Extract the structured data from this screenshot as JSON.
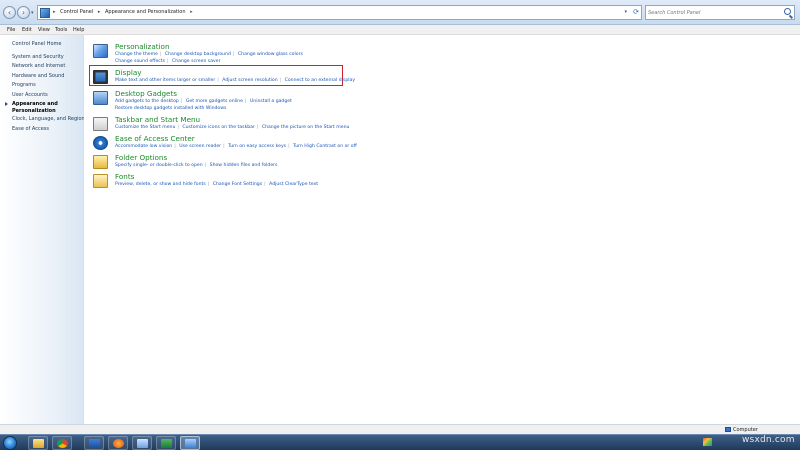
{
  "address_bar": {
    "breadcrumbs": [
      "Control Panel",
      "Appearance and Personalization"
    ],
    "search_placeholder": "Search Control Panel"
  },
  "menu": [
    "File",
    "Edit",
    "View",
    "Tools",
    "Help"
  ],
  "sidebar": {
    "items": [
      {
        "label": "Control Panel Home"
      },
      {
        "label": "System and Security"
      },
      {
        "label": "Network and Internet"
      },
      {
        "label": "Hardware and Sound"
      },
      {
        "label": "Programs"
      },
      {
        "label": "User Accounts"
      },
      {
        "label": "Appearance and"
      },
      {
        "label": "Personalization"
      },
      {
        "label": "Clock, Language, and Region"
      },
      {
        "label": "Ease of Access"
      }
    ]
  },
  "categories": [
    {
      "title": "Personalization",
      "icon": "personalization-icon",
      "links": [
        "Change the theme",
        "Change desktop background",
        "Change window glass colors",
        "Change sound effects",
        "Change screen saver"
      ]
    },
    {
      "title": "Display",
      "icon": "display-icon",
      "links": [
        "Make text and other items larger or smaller",
        "Adjust screen resolution",
        "Connect to an external display"
      ]
    },
    {
      "title": "Desktop Gadgets",
      "icon": "gadgets-icon",
      "links": [
        "Add gadgets to the desktop",
        "Get more gadgets online",
        "Uninstall a gadget",
        "Restore desktop gadgets installed with Windows"
      ]
    },
    {
      "title": "Taskbar and Start Menu",
      "icon": "taskbar-icon",
      "links": [
        "Customize the Start menu",
        "Customize icons on the taskbar",
        "Change the picture on the Start menu"
      ]
    },
    {
      "title": "Ease of Access Center",
      "icon": "ease-of-access-icon",
      "links": [
        "Accommodate low vision",
        "Use screen reader",
        "Turn on easy access keys",
        "Turn High Contrast on or off"
      ]
    },
    {
      "title": "Folder Options",
      "icon": "folder-options-icon",
      "links": [
        "Specify single- or double-click to open",
        "Show hidden files and folders"
      ]
    },
    {
      "title": "Fonts",
      "icon": "fonts-icon",
      "links": [
        "Preview, delete, or show and hide fonts",
        "Change Font Settings",
        "Adjust ClearType text"
      ]
    }
  ],
  "highlight_color": "#d0202c",
  "link_color": "#1a55b6",
  "title_color": "#1b8a2b",
  "status_bar": {
    "label": "Computer"
  },
  "taskbar": {
    "apps": [
      "explorer-icon",
      "chrome-icon",
      "word-icon",
      "firefox-icon",
      "folder-icon",
      "excel-icon",
      "control-panel-icon"
    ]
  },
  "watermark": "wsxdn.com"
}
